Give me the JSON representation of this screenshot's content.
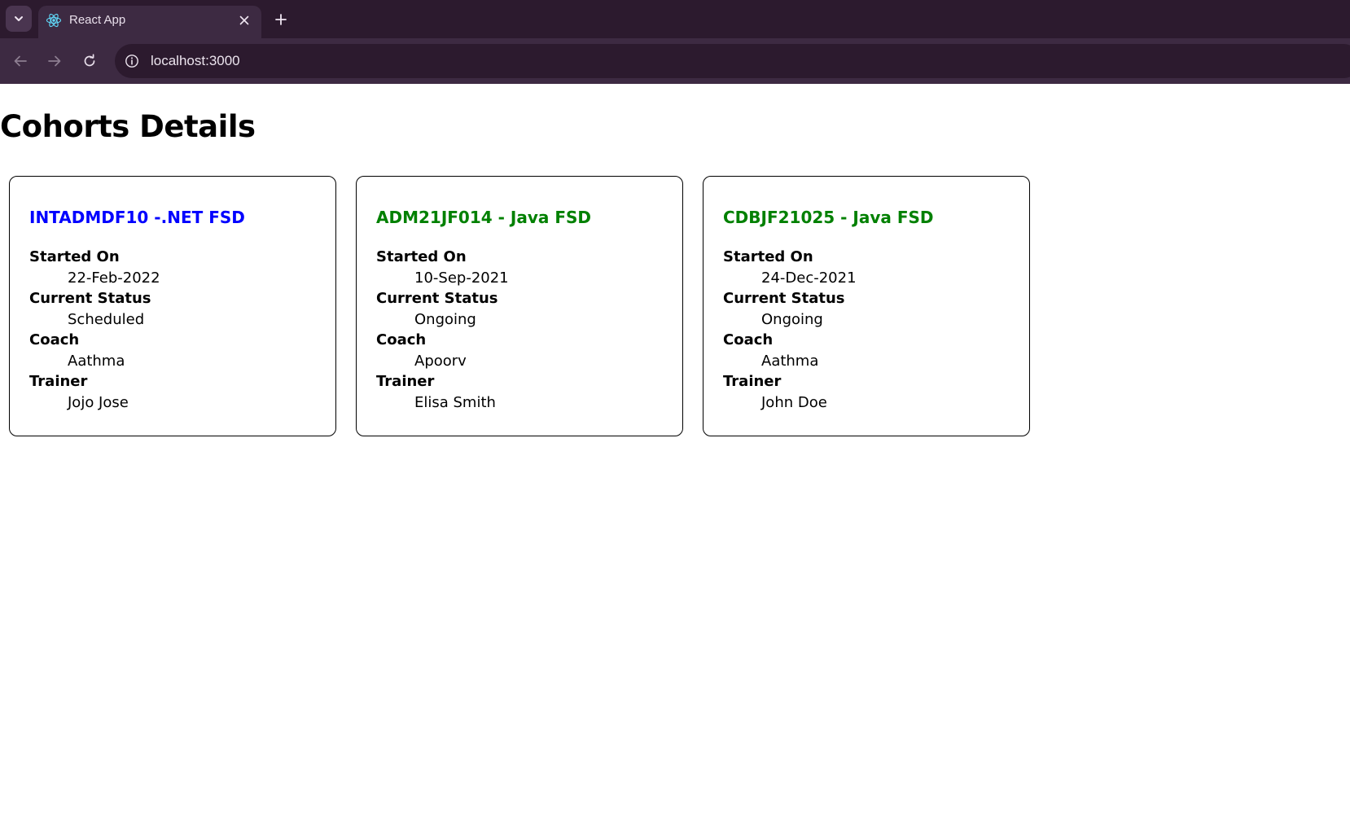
{
  "browser": {
    "tab_title": "React App",
    "url": "localhost:3000",
    "icons": {
      "tab_search": "chevron-down-icon",
      "favicon": "react-logo-icon",
      "tab_close": "close-icon",
      "new_tab": "plus-icon",
      "back": "arrow-left-icon",
      "forward": "arrow-right-icon",
      "reload": "reload-icon",
      "site_info": "info-icon"
    },
    "colors": {
      "tabstrip": "#2c1a2e",
      "toolbar": "#3d2a42"
    }
  },
  "page": {
    "title": "Cohorts Details",
    "labels": {
      "started_on": "Started On",
      "current_status": "Current Status",
      "coach": "Coach",
      "trainer": "Trainer"
    },
    "cohorts": [
      {
        "title": "INTADMDF10 -.NET FSD",
        "title_color": "#0000ff",
        "started_on": "22-Feb-2022",
        "current_status": "Scheduled",
        "coach": "Aathma",
        "trainer": "Jojo Jose"
      },
      {
        "title": "ADM21JF014 - Java FSD",
        "title_color": "#008000",
        "started_on": "10-Sep-2021",
        "current_status": "Ongoing",
        "coach": "Apoorv",
        "trainer": "Elisa Smith"
      },
      {
        "title": "CDBJF21025 - Java FSD",
        "title_color": "#008000",
        "started_on": "24-Dec-2021",
        "current_status": "Ongoing",
        "coach": "Aathma",
        "trainer": "John Doe"
      }
    ]
  }
}
